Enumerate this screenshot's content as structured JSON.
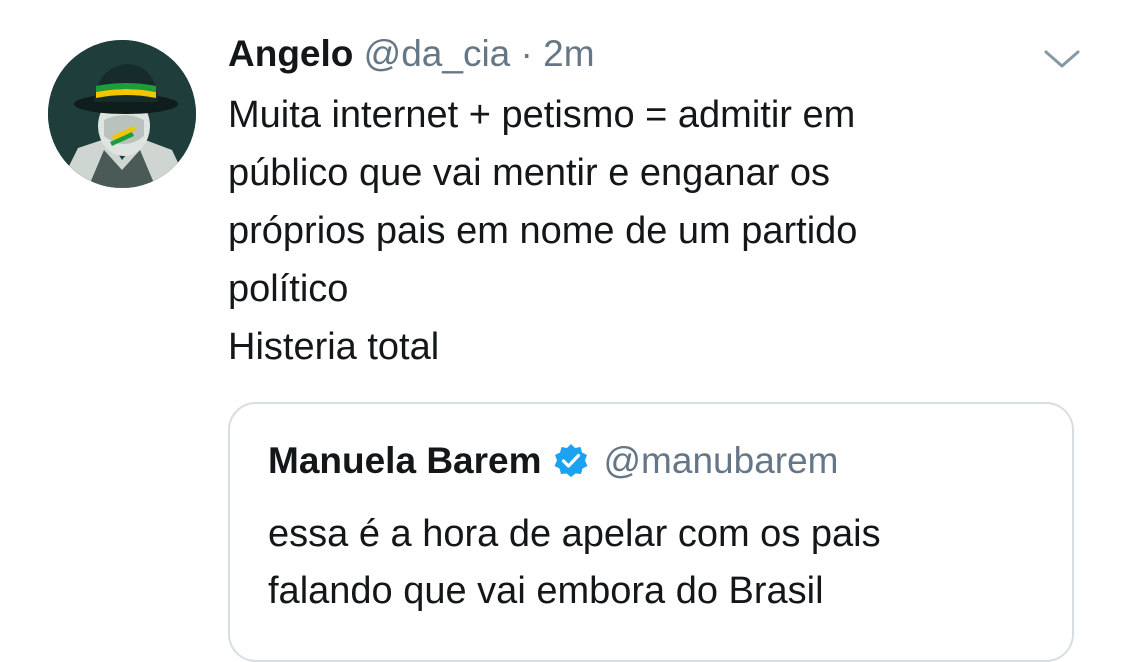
{
  "tweet": {
    "author_name": "Angelo",
    "author_handle": "@da_cia",
    "separator": "·",
    "timestamp": "2m",
    "avatar_icon": "fedora-man-avatar-icon",
    "menu_icon": "chevron-down-icon",
    "text_lines": [
      "Muita internet + petismo = admitir em",
      "público que vai mentir e enganar os",
      "próprios pais em nome de um partido",
      "político",
      "Histeria total"
    ]
  },
  "quoted_tweet": {
    "author_name": "Manuela Barem",
    "verified_icon": "verified-badge-icon",
    "author_handle": "@manubarem",
    "text_lines": [
      "essa é a hora de apelar com os pais",
      "falando que vai embora do Brasil"
    ]
  },
  "colors": {
    "text_primary": "#14171a",
    "text_secondary": "#657786",
    "verified_blue": "#1da1f2",
    "border": "#d7dee3",
    "avatar_bg": "#1f3d3b"
  }
}
